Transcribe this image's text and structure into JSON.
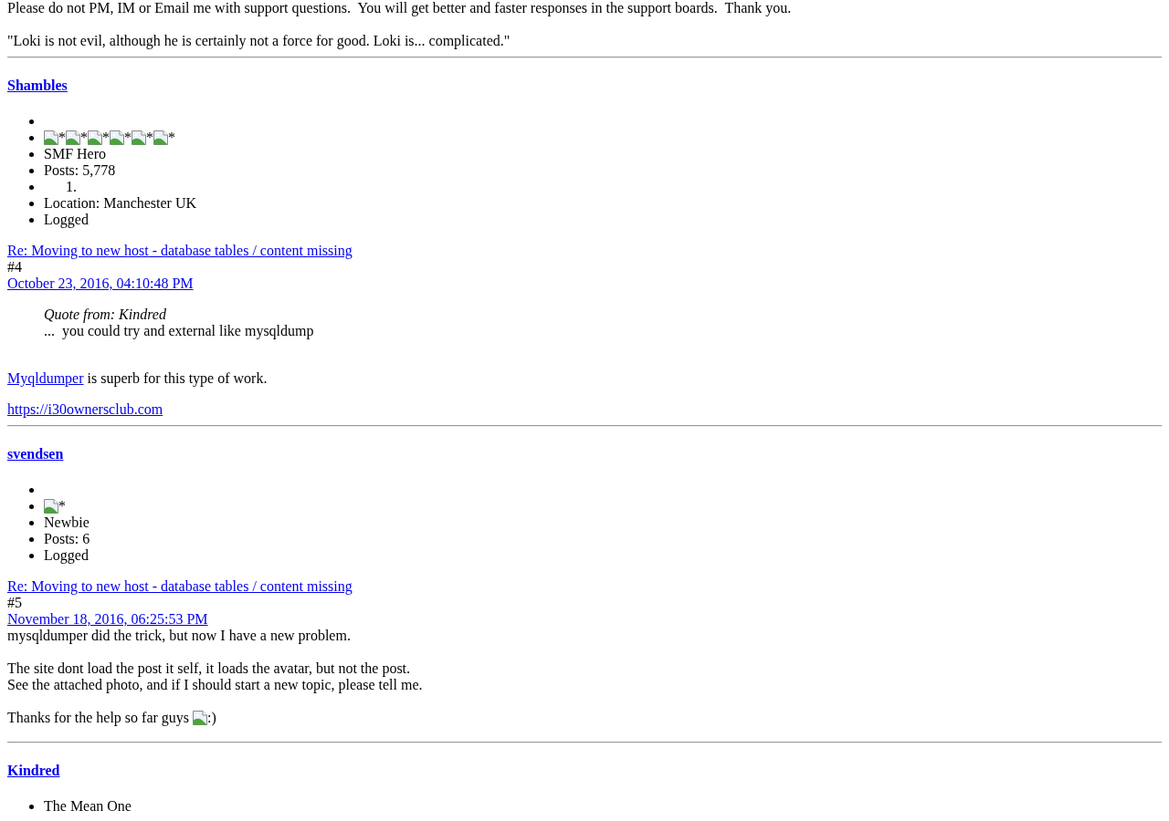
{
  "previous_signature": {
    "lines": [
      "Please do not PM, IM or Email me with support questions.  You will get better and faster responses in the support boards.  Thank you.",
      "\"Loki is not evil, although he is certainly not a force for good. Loki is... complicated.\""
    ]
  },
  "posts": [
    {
      "author": "Shambles",
      "profile": [
        {
          "kind": "blank"
        },
        {
          "kind": "rank_images",
          "images": [
            {
              "alt": "*"
            },
            {
              "alt": "*"
            },
            {
              "alt": "*"
            },
            {
              "alt": "*"
            },
            {
              "alt": "*"
            },
            {
              "alt": "*"
            }
          ]
        },
        {
          "kind": "rank",
          "text": "SMF Hero"
        },
        {
          "kind": "post_count",
          "text": "Posts: 5,778"
        },
        {
          "kind": "numbered",
          "number": "1."
        },
        {
          "kind": "location",
          "text": "Location: Manchester UK"
        },
        {
          "kind": "status",
          "text": "Logged"
        }
      ],
      "title": "Re: Moving to new host - database tables / content missing",
      "number": "#4",
      "date": "October 23, 2016, 04:10:48 PM",
      "body": [
        {
          "kind": "quote",
          "header": "Quote from: Kindred",
          "text": "...  you could try and external like mysqldump"
        },
        {
          "kind": "paragraph",
          "segments": [
            {
              "text": "Myqldumper",
              "link": true
            },
            {
              "text": " is superb for this type of work.",
              "link": false
            }
          ]
        }
      ],
      "signature": {
        "link": "https://i30ownersclub.com"
      }
    },
    {
      "author": "svendsen",
      "profile": [
        {
          "kind": "blank"
        },
        {
          "kind": "rank_images",
          "images": [
            {
              "alt": "*"
            }
          ]
        },
        {
          "kind": "rank",
          "text": "Newbie"
        },
        {
          "kind": "post_count",
          "text": "Posts: 6"
        },
        {
          "kind": "status",
          "text": "Logged"
        }
      ],
      "title": "Re: Moving to new host - database tables / content missing",
      "number": "#5",
      "date": "November 18, 2016, 06:25:53 PM",
      "body": [
        {
          "kind": "paragraph",
          "segments": [
            {
              "text": "mysqldumper did the trick, but now I have a new problem.",
              "link": false
            }
          ]
        },
        {
          "kind": "lines",
          "lines": [
            "The site dont load the post it self, it loads the avatar, but not the post.",
            "See the attached photo, and if I should start a new topic, please tell me."
          ]
        },
        {
          "kind": "text_with_image",
          "text": "Thanks for the help so far guys",
          "image": {
            "alt": ":)"
          }
        }
      ]
    },
    {
      "author": "Kindred",
      "profile": [
        {
          "kind": "rank",
          "text": "The Mean One"
        }
      ]
    }
  ]
}
